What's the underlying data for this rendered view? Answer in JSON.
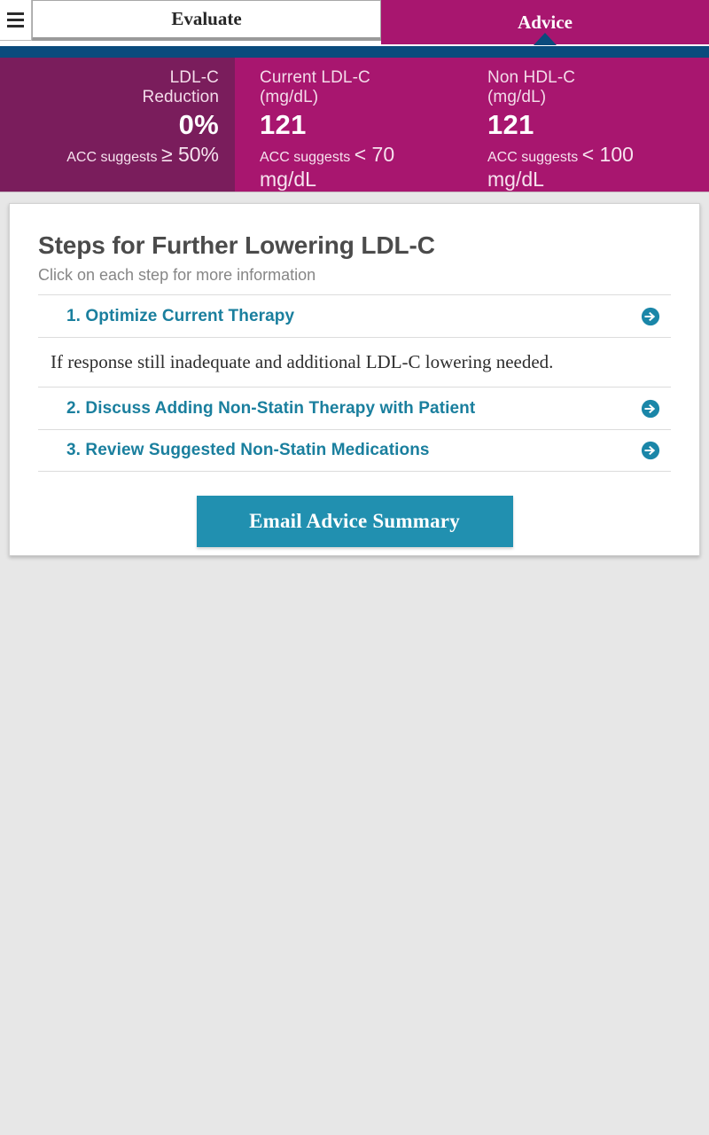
{
  "tabs": {
    "menu_icon": "hamburger-menu-icon",
    "items": [
      {
        "label": "Evaluate",
        "active": false
      },
      {
        "label": "Advice",
        "active": true
      }
    ]
  },
  "stats": [
    {
      "label_line1": "LDL-C",
      "label_line2": "Reduction",
      "value": "0%",
      "sub_prefix": "ACC suggests",
      "sub_threshold": "≥ 50%",
      "sub_unit": ""
    },
    {
      "label_line1": "Current LDL-C",
      "label_line2": "(mg/dL)",
      "value": "121",
      "sub_prefix": "ACC suggests",
      "sub_threshold": "< 70",
      "sub_unit": "mg/dL"
    },
    {
      "label_line1": "Non HDL-C",
      "label_line2": "(mg/dL)",
      "value": "121",
      "sub_prefix": "ACC suggests",
      "sub_threshold": "< 100",
      "sub_unit": "mg/dL"
    }
  ],
  "card": {
    "title": "Steps for Further Lowering LDL-C",
    "subtitle": "Click on each step for more information",
    "steps": [
      {
        "label": "1. Optimize Current Therapy",
        "icon": "arrow-circle-right-icon"
      },
      {
        "label": "2. Discuss Adding Non-Statin Therapy with Patient",
        "icon": "arrow-circle-right-icon"
      },
      {
        "label": "3. Review Suggested Non-Statin Medications",
        "icon": "arrow-circle-right-icon"
      }
    ],
    "note": "If response still inadequate and additional LDL-C lowering needed.",
    "email_button": "Email Advice Summary"
  },
  "colors": {
    "tab_active_bg": "#a8166f",
    "navstrip": "#0a4b7d",
    "stat_panel_dark": "#7a1d5c",
    "stat_panel_bright": "#a8166f",
    "link_teal": "#1a7f9e",
    "button_teal": "#2190b0",
    "page_bg": "#e7e7e7"
  }
}
